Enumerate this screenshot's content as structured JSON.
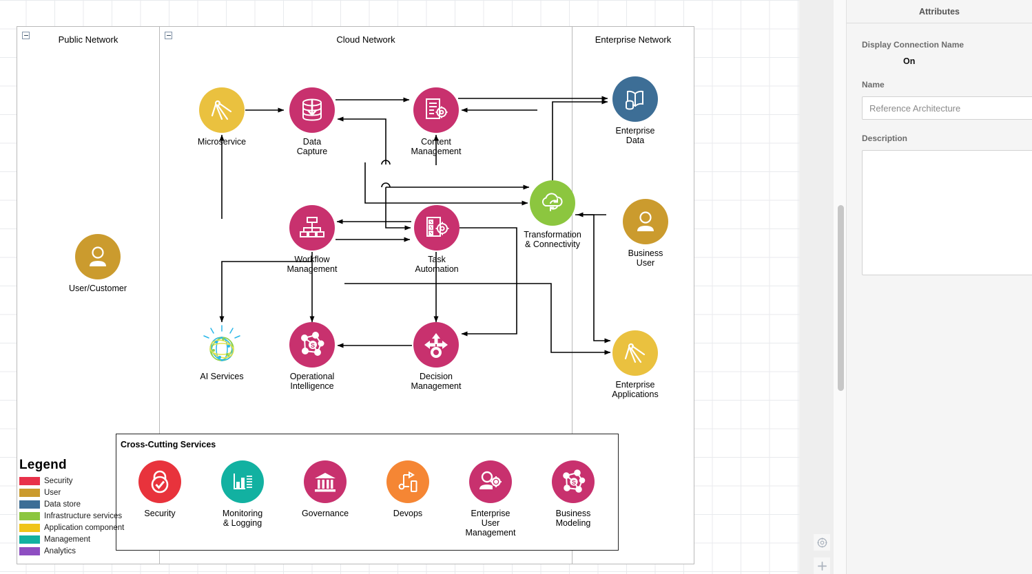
{
  "canvas": {
    "networks": [
      {
        "id": "public",
        "title": "Public Network"
      },
      {
        "id": "cloud",
        "title": "Cloud Network"
      },
      {
        "id": "enterprise",
        "title": "Enterprise Network"
      }
    ],
    "nodes": [
      {
        "id": "user-customer",
        "label": "User/Customer",
        "color": "#cb9b2e",
        "icon": "user-icon"
      },
      {
        "id": "microservice",
        "label": "Microservice",
        "color": "#eac13f",
        "icon": "microservice-icon"
      },
      {
        "id": "data-capture",
        "label": "Data\nCapture",
        "color": "#c8316e",
        "icon": "data-capture-icon"
      },
      {
        "id": "content-management",
        "label": "Content\nManagement",
        "color": "#c8316e",
        "icon": "content-management-icon"
      },
      {
        "id": "enterprise-data",
        "label": "Enterprise\nData",
        "color": "#3d6e96",
        "icon": "enterprise-data-icon"
      },
      {
        "id": "workflow-management",
        "label": "Workflow\nManagement",
        "color": "#c8316e",
        "icon": "workflow-icon"
      },
      {
        "id": "task-automation",
        "label": "Task\nAutomation",
        "color": "#c8316e",
        "icon": "task-automation-icon"
      },
      {
        "id": "transformation",
        "label": "Transformation\n& Connectivity",
        "color": "#8cc63f",
        "icon": "cloud-sync-icon"
      },
      {
        "id": "business-user",
        "label": "Business\nUser",
        "color": "#cb9b2e",
        "icon": "user-icon"
      },
      {
        "id": "ai-services",
        "label": "AI Services",
        "color": "none",
        "icon": "ai-globe-icon"
      },
      {
        "id": "operational-intelligence",
        "label": "Operational\nIntelligence",
        "color": "#c8316e",
        "icon": "operational-intelligence-icon"
      },
      {
        "id": "decision-management",
        "label": "Decision\nManagement",
        "color": "#c8316e",
        "icon": "decision-icon"
      },
      {
        "id": "enterprise-applications",
        "label": "Enterprise\nApplications",
        "color": "#eac13f",
        "icon": "microservice-icon"
      }
    ],
    "cross_cutting": {
      "title": "Cross-Cutting Services",
      "items": [
        {
          "id": "security",
          "label": "Security",
          "color": "#e8333c",
          "icon": "lock-check-icon"
        },
        {
          "id": "monitoring",
          "label": "Monitoring\n& Logging",
          "color": "#12b1a1",
          "icon": "bar-chart-icon"
        },
        {
          "id": "governance",
          "label": "Governance",
          "color": "#c8316e",
          "icon": "bank-icon"
        },
        {
          "id": "devops",
          "label": "Devops",
          "color": "#f58634",
          "icon": "devops-flow-icon"
        },
        {
          "id": "eum",
          "label": "Enterprise\nUser\nManagement",
          "color": "#c8316e",
          "icon": "user-gear-icon"
        },
        {
          "id": "modeling",
          "label": "Business\nModeling",
          "color": "#c8316e",
          "icon": "business-modeling-icon"
        }
      ]
    },
    "legend": {
      "title": "Legend",
      "entries": [
        {
          "label": "Security",
          "color": "#e8314a"
        },
        {
          "label": "User",
          "color": "#cb9b2e"
        },
        {
          "label": "Data store",
          "color": "#3d6e96"
        },
        {
          "label": "Infrastructure services",
          "color": "#8cc63f"
        },
        {
          "label": "Application component",
          "color": "#f0c419"
        },
        {
          "label": "Management",
          "color": "#12b1a1"
        },
        {
          "label": "Analytics",
          "color": "#8e4ec2"
        }
      ]
    }
  },
  "panel": {
    "title": "Attributes",
    "display_connection_name_label": "Display Connection Name",
    "display_connection_name_value": "On",
    "name_label": "Name",
    "name_value": "Reference Architecture",
    "description_label": "Description",
    "description_value": ""
  },
  "controls": {
    "navigator_icon": "navigator-icon",
    "zoom_in_icon": "plus-icon"
  }
}
